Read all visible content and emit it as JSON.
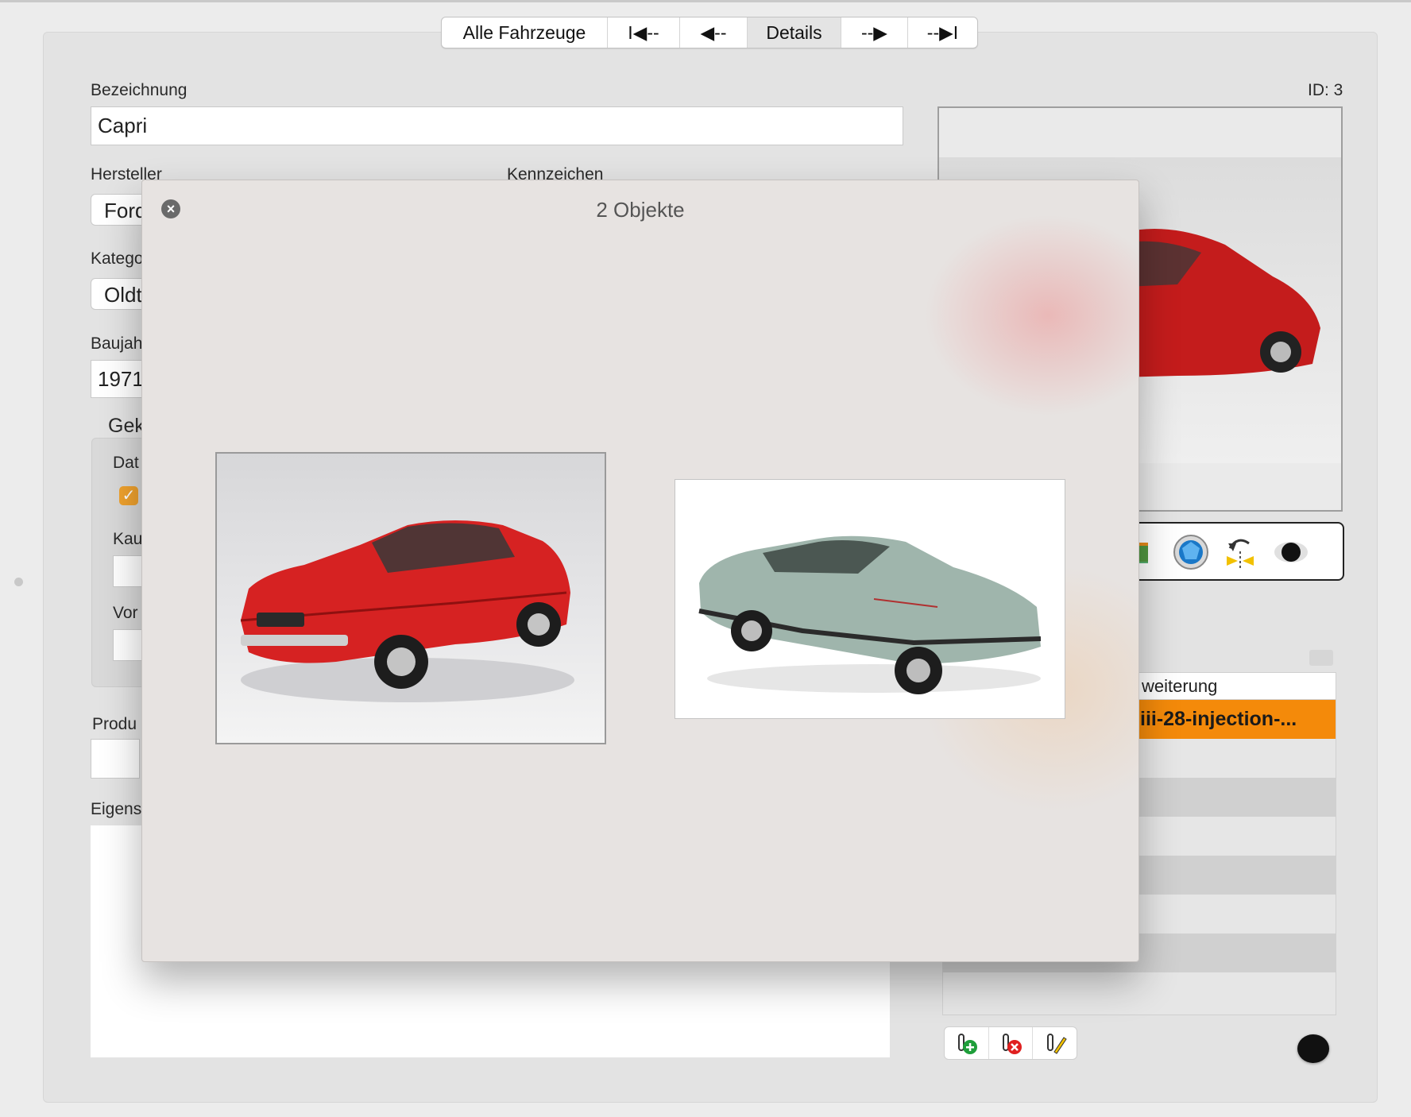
{
  "nav": {
    "segments": [
      {
        "label": "Alle Fahrzeuge"
      },
      {
        "label": "I◀--"
      },
      {
        "label": "◀--"
      },
      {
        "label": "Details"
      },
      {
        "label": "--▶"
      },
      {
        "label": "--▶I"
      }
    ],
    "selected_label": "Details"
  },
  "form": {
    "id_label": "ID: 3",
    "bezeichnung_label": "Bezeichnung",
    "bezeichnung_value": "Capri",
    "hersteller_label": "Hersteller",
    "hersteller_value": "Ford",
    "kennzeichen_label": "Kennzeichen",
    "kategorie_label": "Katego",
    "kategorie_value": "Oldt",
    "baujahr_label": "Baujah",
    "baujahr_value": "1971",
    "group_label": "Gek",
    "dat_label": "Dat",
    "kau_label": "Kau",
    "vor_label": "Vor",
    "produ_label": "Produ",
    "eigens_label": "Eigens"
  },
  "attachments": {
    "header": "weiterung",
    "selected_item": "iii-28-injection-..."
  },
  "toolbar_icons": [
    "image-icon",
    "aperture-icon",
    "flip-icon",
    "eye-icon"
  ],
  "attachment_buttons": [
    "add-attachment-icon",
    "remove-attachment-icon",
    "edit-attachment-icon"
  ],
  "overlay": {
    "title": "2 Objekte",
    "items": [
      {
        "name": "red-car-thumbnail",
        "color": "#d62222"
      },
      {
        "name": "green-car-thumbnail",
        "color": "#9fb5ac"
      }
    ]
  },
  "colors": {
    "accent_orange": "#f48a0a",
    "checkbox_orange": "#f0a22e"
  }
}
